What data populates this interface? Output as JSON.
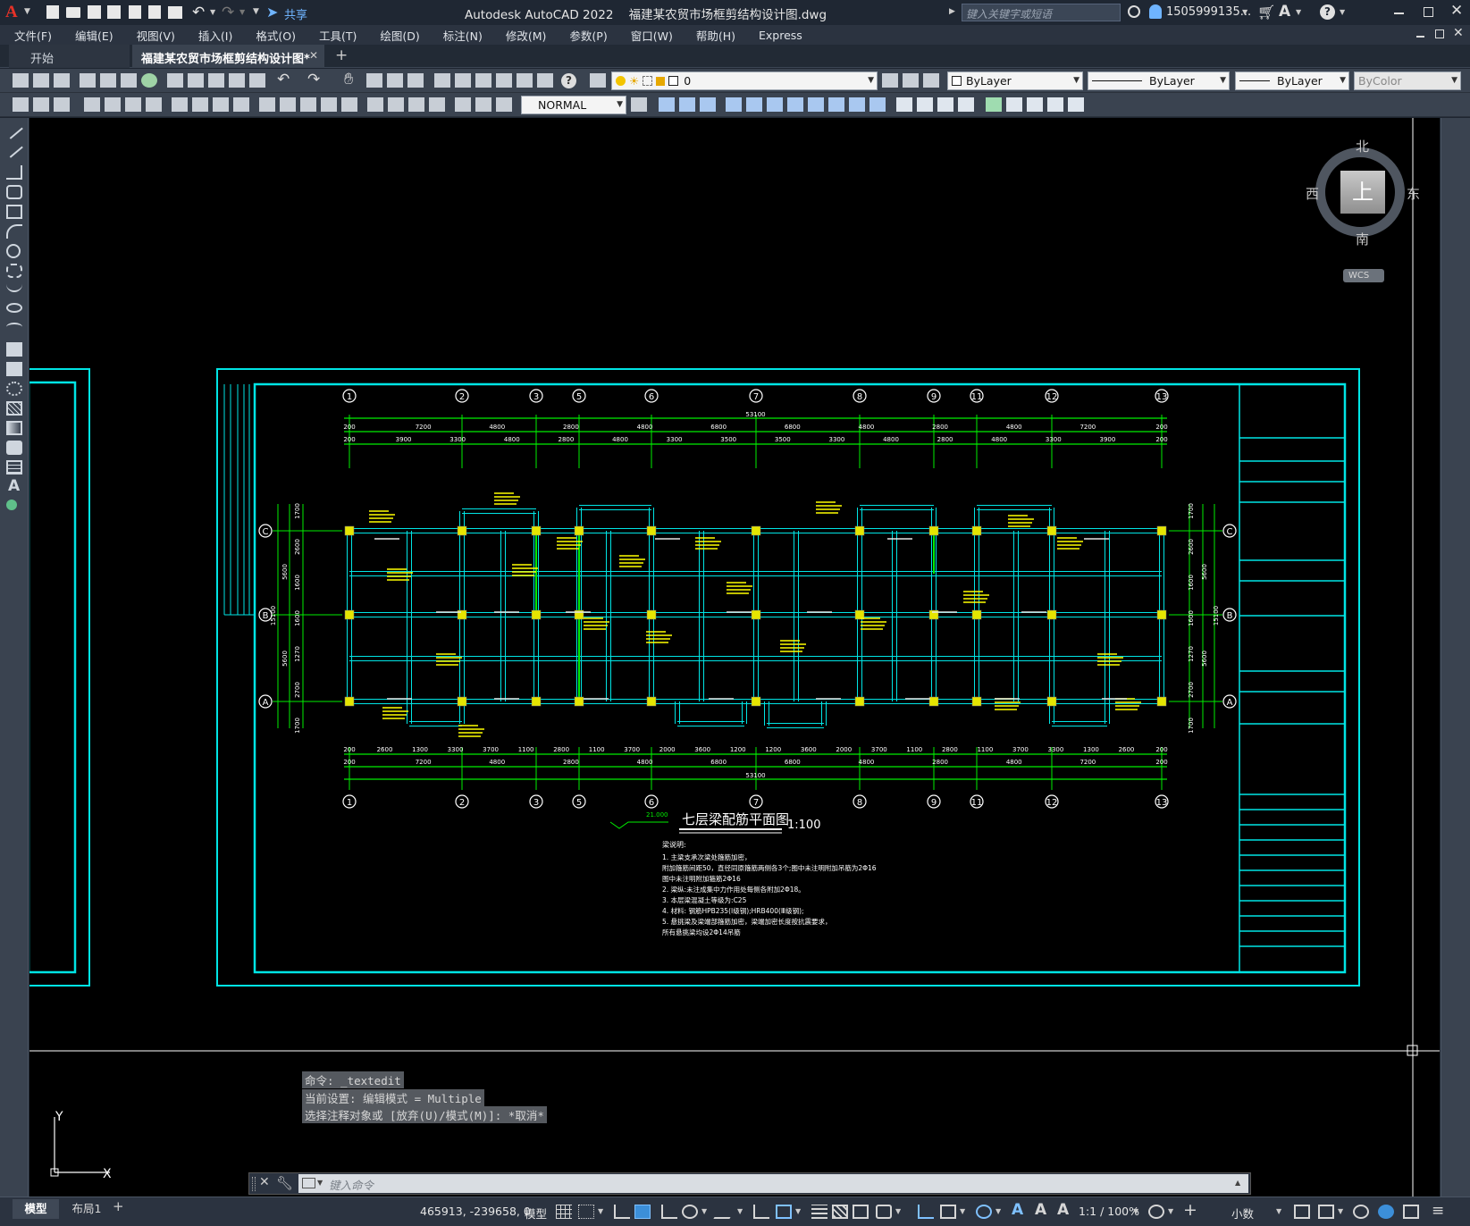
{
  "titlebar": {
    "app_logo": "A",
    "share_label": "共享",
    "title": "Autodesk AutoCAD 2022    福建某农贸市场框剪结构设计图.dwg",
    "search_placeholder": "键入关键字或短语",
    "user": "1505999135...",
    "help": "?"
  },
  "menu": [
    "文件(F)",
    "编辑(E)",
    "视图(V)",
    "插入(I)",
    "格式(O)",
    "工具(T)",
    "绘图(D)",
    "标注(N)",
    "修改(M)",
    "参数(P)",
    "窗口(W)",
    "帮助(H)",
    "Express"
  ],
  "tabs": {
    "start": "开始",
    "active": "福建某农贸市场框剪结构设计图*",
    "plus": "+"
  },
  "toolbar": {
    "layer_value": "0",
    "color_value": "ByLayer",
    "linetype_value": "ByLayer",
    "lineweight_value": "ByLayer",
    "plotstyle_value": "ByColor",
    "style_value": "NORMAL"
  },
  "viewcube": {
    "north": "北",
    "south": "南",
    "east": "东",
    "west": "西",
    "face": "上",
    "wcs": "WCS"
  },
  "drawing": {
    "grid_top": [
      "1",
      "2",
      "3",
      "5",
      "6",
      "7",
      "8",
      "9",
      "11",
      "12",
      "13"
    ],
    "grid_side": [
      "C",
      "B",
      "A"
    ],
    "total_dim": "53100",
    "dims_top_row1": [
      "200",
      "7200",
      "4800",
      "2800",
      "4800",
      "6800",
      "6800",
      "4800",
      "2800",
      "4800",
      "7200",
      "200"
    ],
    "dims_top_row2": [
      "200",
      "3900",
      "3300",
      "4800",
      "2800",
      "4800",
      "3300",
      "3500",
      "3500",
      "3300",
      "4800",
      "2800",
      "4800",
      "3300",
      "3900",
      "200"
    ],
    "dims_bot_row1": [
      "200",
      "2600",
      "1300",
      "3300",
      "3700",
      "1100",
      "2800",
      "1100",
      "3700",
      "2000",
      "3600",
      "1200",
      "1200",
      "3600",
      "2000",
      "3700",
      "1100",
      "2800",
      "1100",
      "3700",
      "3300",
      "1300",
      "2600",
      "200"
    ],
    "dims_bot_row2": [
      "200",
      "7200",
      "4800",
      "2800",
      "4800",
      "6800",
      "6800",
      "4800",
      "2800",
      "4800",
      "7200",
      "200"
    ],
    "dims_left": [
      "1700",
      "2600",
      "1600",
      "1600",
      "1270",
      "2700",
      "1700"
    ],
    "dims_left_outer": [
      "5600",
      "5600"
    ],
    "dims_left_total": "15100",
    "plan_title": "七层梁配筋平面图",
    "plan_scale": "1:100",
    "elevation": "21.000",
    "notes_title": "梁说明:",
    "notes": [
      "1. 主梁支承次梁处箍筋加密，",
      "   附加箍筋间距50，直径同原箍筋两侧各3个;图中未注明附加吊筋为2Φ16",
      "   图中未注明附加箍筋2Φ16",
      "2. 梁纵:未注成集中力作用处每侧各附加2Φ18。",
      "3. 本层梁混凝土等级为:C25",
      "4. 材料: 钢筋HPB235(Ⅰ级钢);HRB400(Ⅲ级钢);",
      "5. 悬挑梁及梁端部箍筋加密，梁端加密长度按抗震要求，",
      "   所有悬挑梁均设2Φ14吊筋"
    ]
  },
  "command": {
    "history": [
      "命令: _textedit",
      "当前设置: 编辑模式 = Multiple",
      "选择注释对象或 [放弃(U)/模式(M)]: *取消*"
    ],
    "placeholder": "键入命令"
  },
  "ucs": {
    "x": "X",
    "y": "Y"
  },
  "status": {
    "model_tab": "模型",
    "layout_tab": "布局1",
    "plus": "+",
    "coords": "465913, -239658, 0",
    "model_label": "模型",
    "scale": "1:1 / 100%",
    "units": "小数"
  },
  "colors": {
    "canvas": "#000000",
    "frame": "#00e5e5",
    "grid_line": "#00ee00",
    "annotation": "#ffff00",
    "axis_bubble": "#ffffff"
  }
}
